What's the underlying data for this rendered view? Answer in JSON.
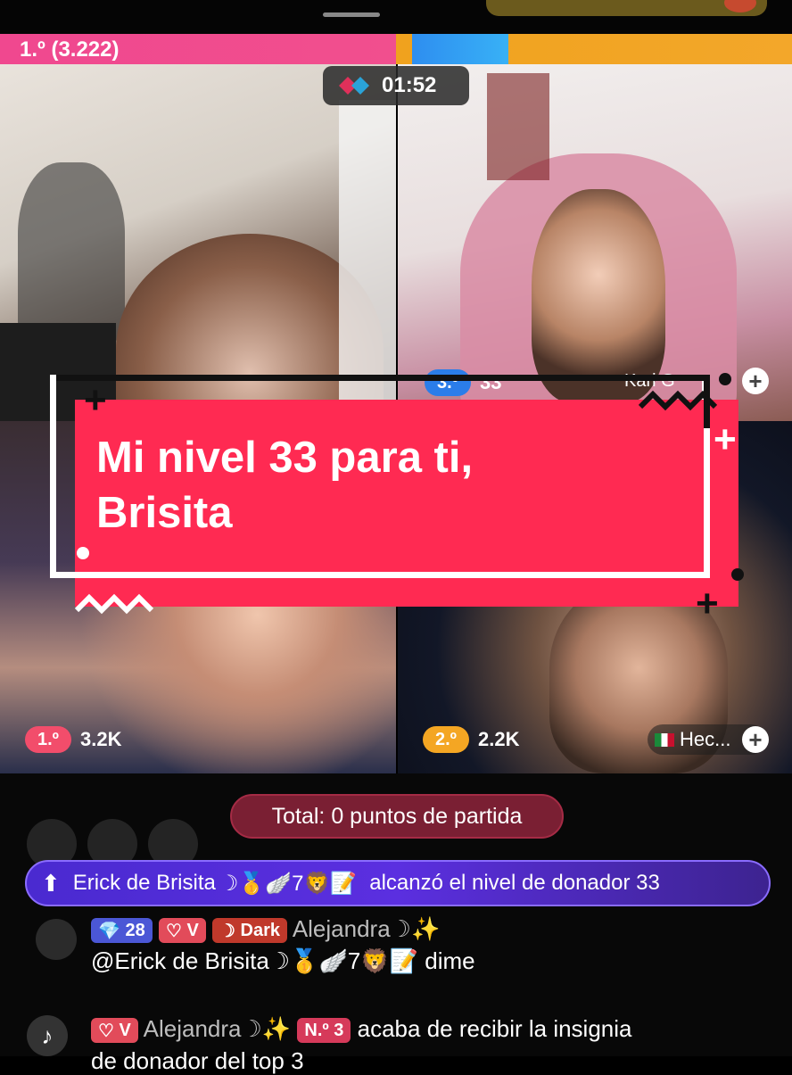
{
  "top": {
    "pill_text": ""
  },
  "score": {
    "left_label": "1.º (3.222)"
  },
  "timer": {
    "text": "01:52"
  },
  "panels": {
    "top_right": {
      "rank": "3.º",
      "score": "33",
      "name": "Kari G"
    },
    "bottom_left": {
      "rank": "1.º",
      "score": "3.2K"
    },
    "bottom_right": {
      "rank": "2.º",
      "score": "2.2K",
      "name": "Hec..."
    }
  },
  "caption": {
    "line1": "Mi nivel 33 para ti,",
    "line2": "Brisita"
  },
  "total": {
    "text": "Total: 0 puntos de partida"
  },
  "donor_banner": {
    "name": "Erick de Brisita",
    "emojis": "☽🥇🪽7🦁📝",
    "message": "alcanzó el nivel de donador 33"
  },
  "chat": [
    {
      "badges": [
        {
          "text": "28",
          "icon": "diamond-icon",
          "color": "#4b57d6"
        },
        {
          "text": "V",
          "icon": "heart-icon",
          "color": "#e24b5a"
        },
        {
          "text": "Dark",
          "icon": "moon-icon",
          "color": "#c0392b"
        }
      ],
      "name": "Alejandra☽✨",
      "message": "@Erick de Brisita☽🥇🪽7🦁📝 dime"
    },
    {
      "badges": [
        {
          "text": "V",
          "icon": "heart-icon",
          "color": "#e24b5a"
        },
        {
          "text": "N.º 3",
          "icon": "medal-icon",
          "color": "#d63a5a"
        }
      ],
      "name": "Alejandra☽✨",
      "message": "acaba de recibir la insignia",
      "message_cont": "de donador del top 3"
    }
  ],
  "colors": {
    "caption_bg": "#ff2a52",
    "score_pink": "#f0488f",
    "score_orange": "#f0a21e",
    "score_blue": "#2e8ef0",
    "donor_purple": "#4a2ad0"
  }
}
